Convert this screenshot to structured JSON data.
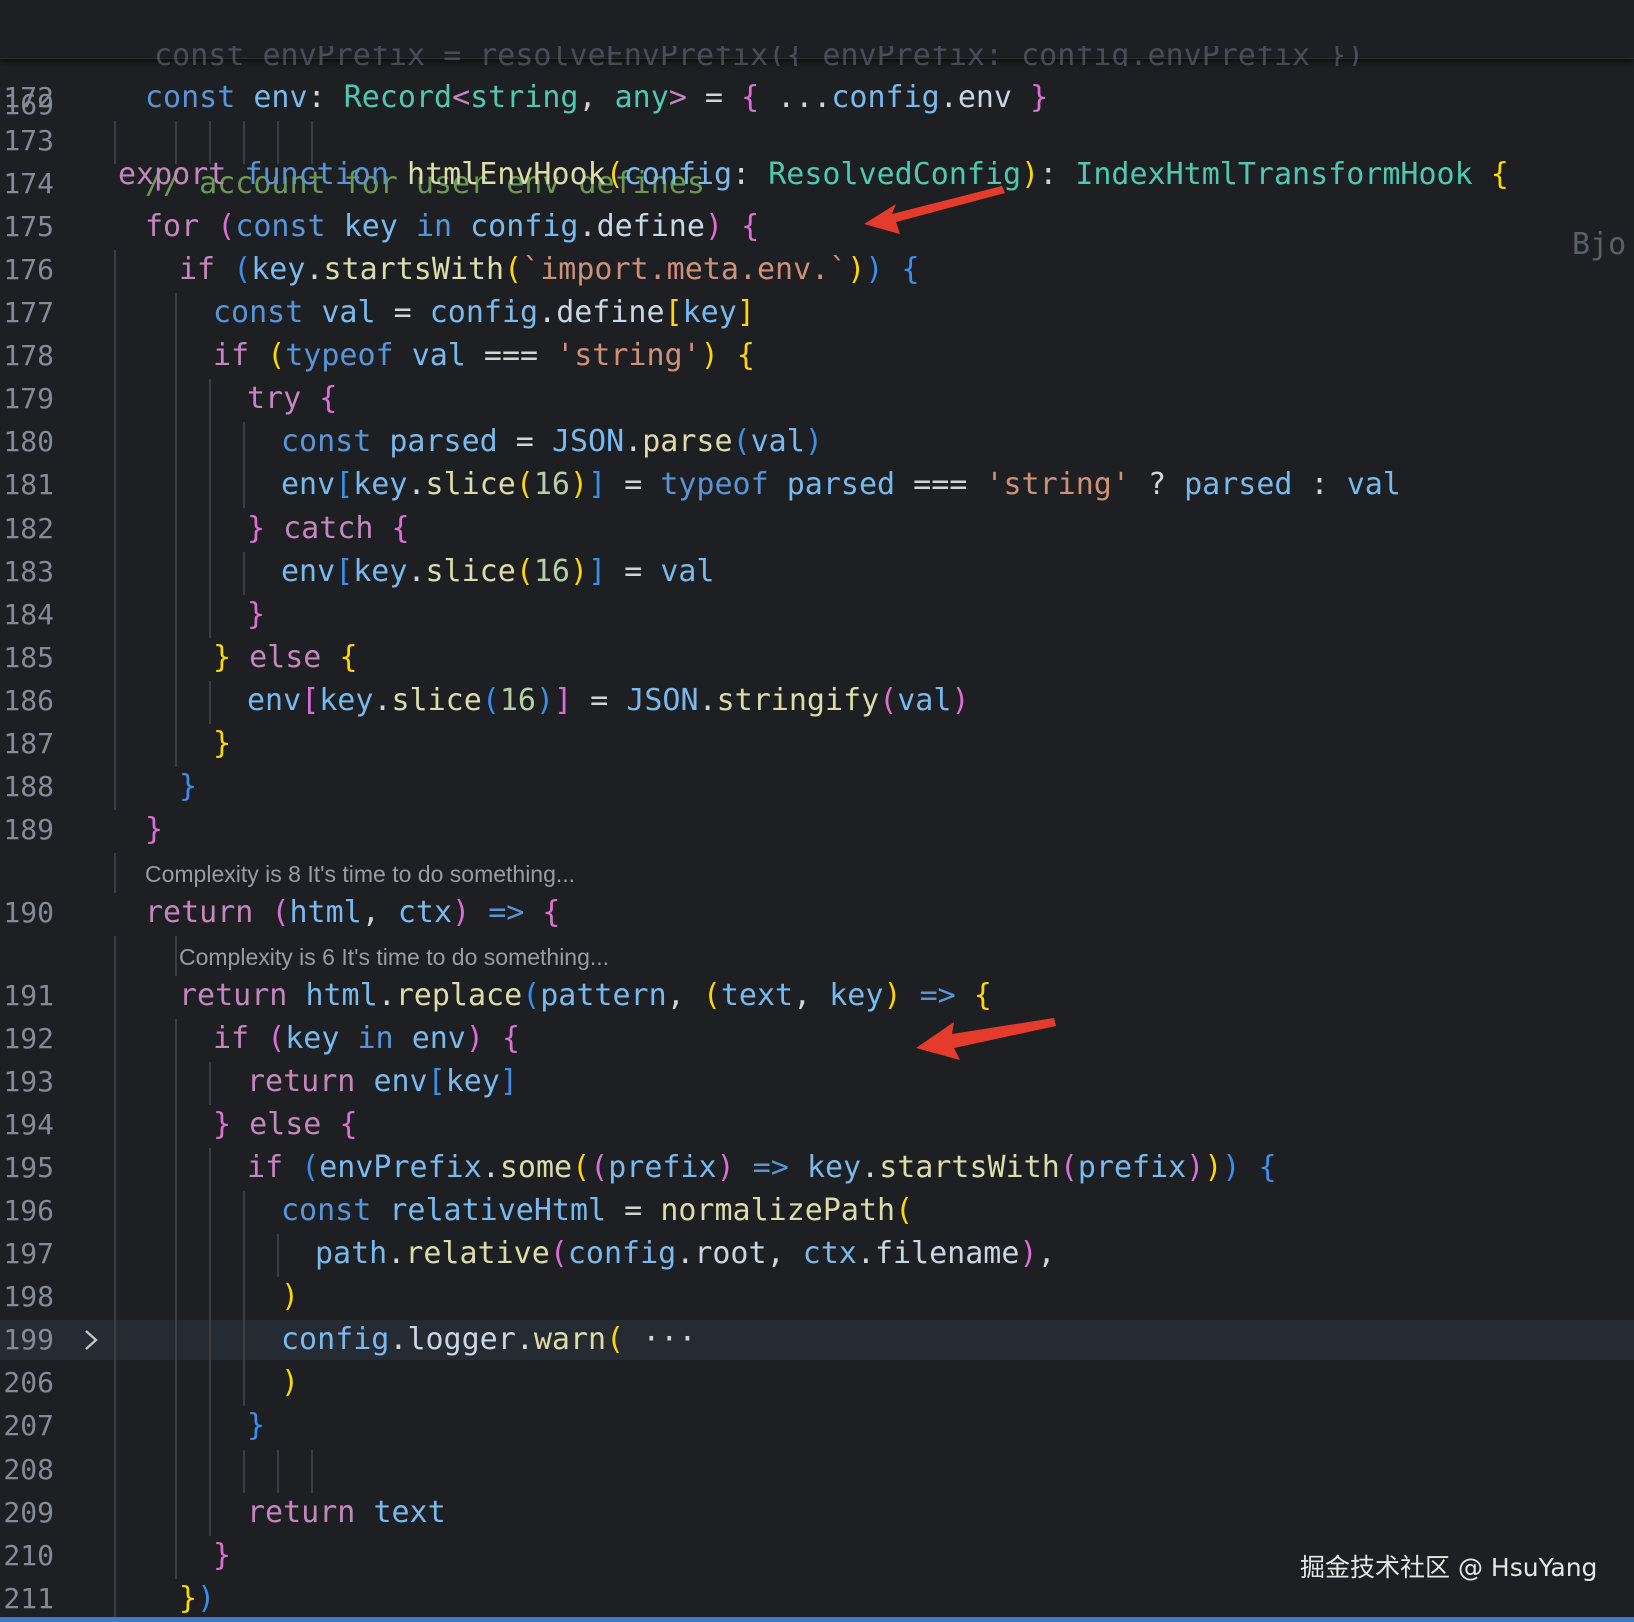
{
  "sticky_header": {
    "line_number": "169",
    "tokens": [
      [
        "k",
        "export"
      ],
      [
        "p",
        " "
      ],
      [
        "sk",
        "function"
      ],
      [
        "p",
        " "
      ],
      [
        "f",
        "htmlEnvHook"
      ],
      [
        "b1",
        "("
      ],
      [
        "v",
        "config"
      ],
      [
        "p",
        ": "
      ],
      [
        "t",
        "ResolvedConfig"
      ],
      [
        "b1",
        ")"
      ],
      [
        "p",
        ": "
      ],
      [
        "t",
        "IndexHtmlTransformHook"
      ],
      [
        "p",
        " "
      ],
      [
        "b1",
        "{"
      ]
    ],
    "truncated_right": "Bjo"
  },
  "ghost_line_text": "  const envPrefix = resolveEnvPrefix({ envPrefix: config.envPrefix })",
  "lines": [
    {
      "ln": "172",
      "indent": 1,
      "tokens": [
        [
          "sk",
          "const"
        ],
        [
          "p",
          " "
        ],
        [
          "v",
          "env"
        ],
        [
          "p",
          ": "
        ],
        [
          "t",
          "Record"
        ],
        [
          "k",
          "<"
        ],
        [
          "t",
          "string"
        ],
        [
          "p",
          ", "
        ],
        [
          "t",
          "any"
        ],
        [
          "k",
          ">"
        ],
        [
          "p",
          " = "
        ],
        [
          "b2",
          "{"
        ],
        [
          "p",
          " ..."
        ],
        [
          "v",
          "config"
        ],
        [
          "p",
          "."
        ],
        [
          "pv",
          "env"
        ],
        [
          "p",
          " "
        ],
        [
          "b2",
          "}"
        ]
      ]
    },
    {
      "ln": "173",
      "indent": 0,
      "tokens": []
    },
    {
      "ln": "174",
      "indent": 1,
      "tokens": [
        [
          "c",
          "// account for user env defines"
        ]
      ]
    },
    {
      "ln": "175",
      "indent": 1,
      "tokens": [
        [
          "k",
          "for"
        ],
        [
          "p",
          " "
        ],
        [
          "b2",
          "("
        ],
        [
          "sk",
          "const"
        ],
        [
          "p",
          " "
        ],
        [
          "v",
          "key"
        ],
        [
          "p",
          " "
        ],
        [
          "sk",
          "in"
        ],
        [
          "p",
          " "
        ],
        [
          "v",
          "config"
        ],
        [
          "p",
          "."
        ],
        [
          "pv",
          "define"
        ],
        [
          "b2",
          ")"
        ],
        [
          "p",
          " "
        ],
        [
          "b2",
          "{"
        ]
      ]
    },
    {
      "ln": "176",
      "indent": 2,
      "tokens": [
        [
          "k",
          "if"
        ],
        [
          "p",
          " "
        ],
        [
          "b3",
          "("
        ],
        [
          "v",
          "key"
        ],
        [
          "p",
          "."
        ],
        [
          "f",
          "startsWith"
        ],
        [
          "b1",
          "("
        ],
        [
          "s",
          "`import.meta.env.`"
        ],
        [
          "b1",
          ")"
        ],
        [
          "b3",
          ")"
        ],
        [
          "p",
          " "
        ],
        [
          "b3",
          "{"
        ]
      ]
    },
    {
      "ln": "177",
      "indent": 3,
      "tokens": [
        [
          "sk",
          "const"
        ],
        [
          "p",
          " "
        ],
        [
          "v",
          "val"
        ],
        [
          "p",
          " = "
        ],
        [
          "v",
          "config"
        ],
        [
          "p",
          "."
        ],
        [
          "pv",
          "define"
        ],
        [
          "b1",
          "["
        ],
        [
          "v",
          "key"
        ],
        [
          "b1",
          "]"
        ]
      ]
    },
    {
      "ln": "178",
      "indent": 3,
      "tokens": [
        [
          "k",
          "if"
        ],
        [
          "p",
          " "
        ],
        [
          "b1",
          "("
        ],
        [
          "sk",
          "typeof"
        ],
        [
          "p",
          " "
        ],
        [
          "v",
          "val"
        ],
        [
          "p",
          " === "
        ],
        [
          "s",
          "'string'"
        ],
        [
          "b1",
          ")"
        ],
        [
          "p",
          " "
        ],
        [
          "b1",
          "{"
        ]
      ]
    },
    {
      "ln": "179",
      "indent": 4,
      "tokens": [
        [
          "k",
          "try"
        ],
        [
          "p",
          " "
        ],
        [
          "b2",
          "{"
        ]
      ]
    },
    {
      "ln": "180",
      "indent": 5,
      "tokens": [
        [
          "sk",
          "const"
        ],
        [
          "p",
          " "
        ],
        [
          "v",
          "parsed"
        ],
        [
          "p",
          " = "
        ],
        [
          "v",
          "JSON"
        ],
        [
          "p",
          "."
        ],
        [
          "f",
          "parse"
        ],
        [
          "b3",
          "("
        ],
        [
          "v",
          "val"
        ],
        [
          "b3",
          ")"
        ]
      ]
    },
    {
      "ln": "181",
      "indent": 5,
      "tokens": [
        [
          "v",
          "env"
        ],
        [
          "b3",
          "["
        ],
        [
          "v",
          "key"
        ],
        [
          "p",
          "."
        ],
        [
          "f",
          "slice"
        ],
        [
          "b1",
          "("
        ],
        [
          "n",
          "16"
        ],
        [
          "b1",
          ")"
        ],
        [
          "b3",
          "]"
        ],
        [
          "p",
          " = "
        ],
        [
          "sk",
          "typeof"
        ],
        [
          "p",
          " "
        ],
        [
          "v",
          "parsed"
        ],
        [
          "p",
          " === "
        ],
        [
          "s",
          "'string'"
        ],
        [
          "p",
          " ? "
        ],
        [
          "v",
          "parsed"
        ],
        [
          "p",
          " : "
        ],
        [
          "v",
          "val"
        ]
      ]
    },
    {
      "ln": "182",
      "indent": 4,
      "tokens": [
        [
          "b2",
          "}"
        ],
        [
          "p",
          " "
        ],
        [
          "k",
          "catch"
        ],
        [
          "p",
          " "
        ],
        [
          "b2",
          "{"
        ]
      ]
    },
    {
      "ln": "183",
      "indent": 5,
      "tokens": [
        [
          "v",
          "env"
        ],
        [
          "b3",
          "["
        ],
        [
          "v",
          "key"
        ],
        [
          "p",
          "."
        ],
        [
          "f",
          "slice"
        ],
        [
          "b1",
          "("
        ],
        [
          "n",
          "16"
        ],
        [
          "b1",
          ")"
        ],
        [
          "b3",
          "]"
        ],
        [
          "p",
          " = "
        ],
        [
          "v",
          "val"
        ]
      ]
    },
    {
      "ln": "184",
      "indent": 4,
      "tokens": [
        [
          "b2",
          "}"
        ]
      ]
    },
    {
      "ln": "185",
      "indent": 3,
      "tokens": [
        [
          "b1",
          "}"
        ],
        [
          "p",
          " "
        ],
        [
          "k",
          "else"
        ],
        [
          "p",
          " "
        ],
        [
          "b1",
          "{"
        ]
      ]
    },
    {
      "ln": "186",
      "indent": 4,
      "tokens": [
        [
          "v",
          "env"
        ],
        [
          "b2",
          "["
        ],
        [
          "v",
          "key"
        ],
        [
          "p",
          "."
        ],
        [
          "f",
          "slice"
        ],
        [
          "b3",
          "("
        ],
        [
          "n",
          "16"
        ],
        [
          "b3",
          ")"
        ],
        [
          "b2",
          "]"
        ],
        [
          "p",
          " = "
        ],
        [
          "v",
          "JSON"
        ],
        [
          "p",
          "."
        ],
        [
          "f",
          "stringify"
        ],
        [
          "b2",
          "("
        ],
        [
          "v",
          "val"
        ],
        [
          "b2",
          ")"
        ]
      ]
    },
    {
      "ln": "187",
      "indent": 3,
      "tokens": [
        [
          "b1",
          "}"
        ]
      ]
    },
    {
      "ln": "188",
      "indent": 2,
      "tokens": [
        [
          "b3",
          "}"
        ]
      ]
    },
    {
      "ln": "189",
      "indent": 1,
      "tokens": [
        [
          "b2",
          "}"
        ]
      ]
    },
    {
      "hint": "Complexity is 8 It's time to do something...",
      "indent": 1
    },
    {
      "ln": "190",
      "indent": 1,
      "tokens": [
        [
          "k",
          "return"
        ],
        [
          "p",
          " "
        ],
        [
          "b2",
          "("
        ],
        [
          "v",
          "html"
        ],
        [
          "p",
          ", "
        ],
        [
          "v",
          "ctx"
        ],
        [
          "b2",
          ")"
        ],
        [
          "p",
          " "
        ],
        [
          "sk",
          "=>"
        ],
        [
          "p",
          " "
        ],
        [
          "b2",
          "{"
        ]
      ]
    },
    {
      "hint": "Complexity is 6 It's time to do something...",
      "indent": 2
    },
    {
      "ln": "191",
      "indent": 2,
      "tokens": [
        [
          "k",
          "return"
        ],
        [
          "p",
          " "
        ],
        [
          "v",
          "html"
        ],
        [
          "p",
          "."
        ],
        [
          "f",
          "replace"
        ],
        [
          "b3",
          "("
        ],
        [
          "v",
          "pattern"
        ],
        [
          "p",
          ", "
        ],
        [
          "b1",
          "("
        ],
        [
          "v",
          "text"
        ],
        [
          "p",
          ", "
        ],
        [
          "v",
          "key"
        ],
        [
          "b1",
          ")"
        ],
        [
          "p",
          " "
        ],
        [
          "sk",
          "=>"
        ],
        [
          "p",
          " "
        ],
        [
          "b1",
          "{"
        ]
      ]
    },
    {
      "ln": "192",
      "indent": 3,
      "tokens": [
        [
          "k",
          "if"
        ],
        [
          "p",
          " "
        ],
        [
          "b2",
          "("
        ],
        [
          "v",
          "key"
        ],
        [
          "p",
          " "
        ],
        [
          "sk",
          "in"
        ],
        [
          "p",
          " "
        ],
        [
          "v",
          "env"
        ],
        [
          "b2",
          ")"
        ],
        [
          "p",
          " "
        ],
        [
          "b2",
          "{"
        ]
      ]
    },
    {
      "ln": "193",
      "indent": 4,
      "tokens": [
        [
          "k",
          "return"
        ],
        [
          "p",
          " "
        ],
        [
          "v",
          "env"
        ],
        [
          "b3",
          "["
        ],
        [
          "v",
          "key"
        ],
        [
          "b3",
          "]"
        ]
      ]
    },
    {
      "ln": "194",
      "indent": 3,
      "tokens": [
        [
          "b2",
          "}"
        ],
        [
          "p",
          " "
        ],
        [
          "k",
          "else"
        ],
        [
          "p",
          " "
        ],
        [
          "b2",
          "{"
        ]
      ]
    },
    {
      "ln": "195",
      "indent": 4,
      "tokens": [
        [
          "k",
          "if"
        ],
        [
          "p",
          " "
        ],
        [
          "b3",
          "("
        ],
        [
          "v",
          "envPrefix"
        ],
        [
          "p",
          "."
        ],
        [
          "f",
          "some"
        ],
        [
          "b1",
          "("
        ],
        [
          "b2",
          "("
        ],
        [
          "v",
          "prefix"
        ],
        [
          "b2",
          ")"
        ],
        [
          "p",
          " "
        ],
        [
          "sk",
          "=>"
        ],
        [
          "p",
          " "
        ],
        [
          "v",
          "key"
        ],
        [
          "p",
          "."
        ],
        [
          "f",
          "startsWith"
        ],
        [
          "b2",
          "("
        ],
        [
          "v",
          "prefix"
        ],
        [
          "b2",
          ")"
        ],
        [
          "b1",
          ")"
        ],
        [
          "b3",
          ")"
        ],
        [
          "p",
          " "
        ],
        [
          "b3",
          "{"
        ]
      ]
    },
    {
      "ln": "196",
      "indent": 5,
      "tokens": [
        [
          "sk",
          "const"
        ],
        [
          "p",
          " "
        ],
        [
          "v",
          "relativeHtml"
        ],
        [
          "p",
          " = "
        ],
        [
          "f",
          "normalizePath"
        ],
        [
          "b1",
          "("
        ]
      ]
    },
    {
      "ln": "197",
      "indent": 6,
      "tokens": [
        [
          "v",
          "path"
        ],
        [
          "p",
          "."
        ],
        [
          "f",
          "relative"
        ],
        [
          "b2",
          "("
        ],
        [
          "v",
          "config"
        ],
        [
          "p",
          "."
        ],
        [
          "pv",
          "root"
        ],
        [
          "p",
          ", "
        ],
        [
          "v",
          "ctx"
        ],
        [
          "p",
          "."
        ],
        [
          "pv",
          "filename"
        ],
        [
          "b2",
          ")"
        ],
        [
          "p",
          ","
        ]
      ]
    },
    {
      "ln": "198",
      "indent": 5,
      "tokens": [
        [
          "b1",
          ")"
        ]
      ]
    },
    {
      "ln": "199",
      "indent": 5,
      "folded": true,
      "cursor": true,
      "tokens": [
        [
          "v",
          "config"
        ],
        [
          "p",
          "."
        ],
        [
          "pv",
          "logger"
        ],
        [
          "p",
          "."
        ],
        [
          "f",
          "warn"
        ],
        [
          "b1",
          "("
        ],
        [
          "p",
          " ···"
        ]
      ]
    },
    {
      "ln": "206",
      "indent": 5,
      "tokens": [
        [
          "b1",
          ")"
        ]
      ]
    },
    {
      "ln": "207",
      "indent": 4,
      "tokens": [
        [
          "b3",
          "}"
        ]
      ]
    },
    {
      "ln": "208",
      "indent": 0,
      "tokens": []
    },
    {
      "ln": "209",
      "indent": 4,
      "tokens": [
        [
          "k",
          "return"
        ],
        [
          "p",
          " "
        ],
        [
          "v",
          "text"
        ]
      ]
    },
    {
      "ln": "210",
      "indent": 3,
      "tokens": [
        [
          "b2",
          "}"
        ]
      ]
    },
    {
      "ln": "211",
      "indent": 2,
      "tokens": [
        [
          "b1",
          "}"
        ],
        [
          "b3",
          ")"
        ]
      ]
    }
  ],
  "watermark": "掘金技术社区 @ HsuYang",
  "colors": {
    "background": "#1e1f22",
    "cursor_line": "#262a33",
    "annotation_arrow": "#e53b2c",
    "status_bar": "#3b79c9"
  },
  "icons": {
    "fold_marker": "chevron-right-icon",
    "annotation": "red-arrow-icon"
  }
}
